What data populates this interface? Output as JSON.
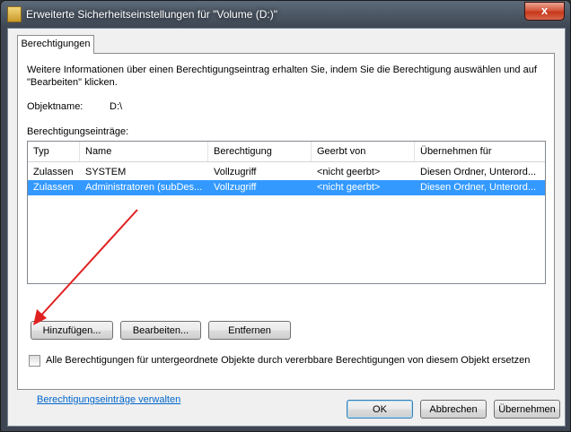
{
  "window": {
    "title": "Erweiterte Sicherheitseinstellungen für \"Volume (D:)\"",
    "close_label": "x"
  },
  "tab": {
    "label": "Berechtigungen"
  },
  "info_text": "Weitere Informationen über einen Berechtigungseintrag erhalten Sie, indem Sie die Berechtigung auswählen und auf \"Bearbeiten\" klicken.",
  "object": {
    "label": "Objektname:",
    "value": "D:\\"
  },
  "entries_label": "Berechtigungseinträge:",
  "table": {
    "columns": [
      "Typ",
      "Name",
      "Berechtigung",
      "Geerbt von",
      "Übernehmen für"
    ],
    "rows": [
      [
        "Zulassen",
        "SYSTEM",
        "Vollzugriff",
        "<nicht geerbt>",
        "Diesen Ordner, Unterord..."
      ],
      [
        "Zulassen",
        "Administratoren (subDes...",
        "Vollzugriff",
        "<nicht geerbt>",
        "Diesen Ordner, Unterord..."
      ]
    ]
  },
  "buttons": {
    "add": "Hinzufügen...",
    "edit": "Bearbeiten...",
    "remove": "Entfernen",
    "ok": "OK",
    "cancel": "Abbrechen",
    "apply": "Übernehmen"
  },
  "checkbox_label": "Alle Berechtigungen für untergeordnete Objekte durch vererbbare Berechtigungen von diesem Objekt ersetzen",
  "manage_link": "Berechtigungseinträge verwalten",
  "colors": {
    "selection": "#3399ff",
    "arrow": "#e02020",
    "link": "#0066cc"
  }
}
